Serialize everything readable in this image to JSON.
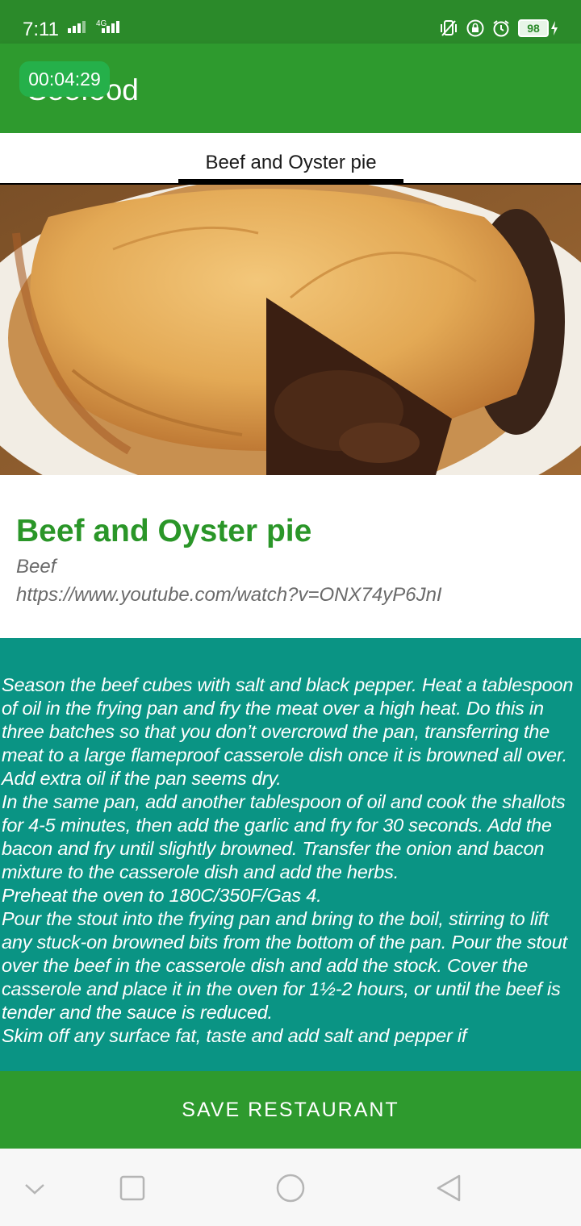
{
  "status_bar": {
    "time": "7:11",
    "network_type": "4G",
    "battery_level": "98",
    "icons": [
      "signal-icon",
      "vibrate-icon",
      "lock-icon",
      "alarm-icon",
      "battery-icon",
      "charging-icon"
    ]
  },
  "app_bar": {
    "title": "Seefood",
    "timer": "00:04:29"
  },
  "tabs": [
    {
      "label": "Beef and Oyster pie",
      "selected": true
    }
  ],
  "recipe": {
    "image": "beef-and-oyster-pie-photo",
    "title": "Beef and Oyster pie",
    "category": "Beef",
    "video_url": "https://www.youtube.com/watch?v=ONX74yP6JnI",
    "instructions": "Season the beef cubes with salt and black pepper. Heat a tablespoon of oil in the frying pan and fry the meat over a high heat. Do this in three batches so that you don’t overcrowd the pan, transferring the meat to a large flameproof casserole dish once it is browned all over. Add extra oil if the pan seems dry.\nIn the same pan, add another tablespoon of oil and cook the shallots for 4-5 minutes, then add the garlic and fry for 30 seconds. Add the bacon and fry until slightly browned. Transfer the onion and bacon mixture to the casserole dish and add the herbs.\nPreheat the oven to 180C/350F/Gas 4.\nPour the stout into the frying pan and bring to the boil, stirring to lift any stuck-on browned bits from the bottom of the pan. Pour the stout over the beef in the casserole dish and add the stock. Cover the casserole and place it in the oven for 1½-2 hours, or until the beef is tender and the sauce is reduced.\nSkim off any surface fat, taste and add salt and pepper if"
  },
  "actions": {
    "save_label": "SAVE RESTAURANT"
  },
  "nav_bar": {
    "buttons": [
      "hide-keyboard-icon",
      "recents-icon",
      "home-icon",
      "back-icon"
    ]
  },
  "colors": {
    "status_bar": "#2b8a2a",
    "app_bar": "#2e9a2e",
    "timer_pill": "#25b04a",
    "recipe_title": "#2a9628",
    "instructions_bg": "#0a9484",
    "nav_bar": "#f7f7f7"
  }
}
